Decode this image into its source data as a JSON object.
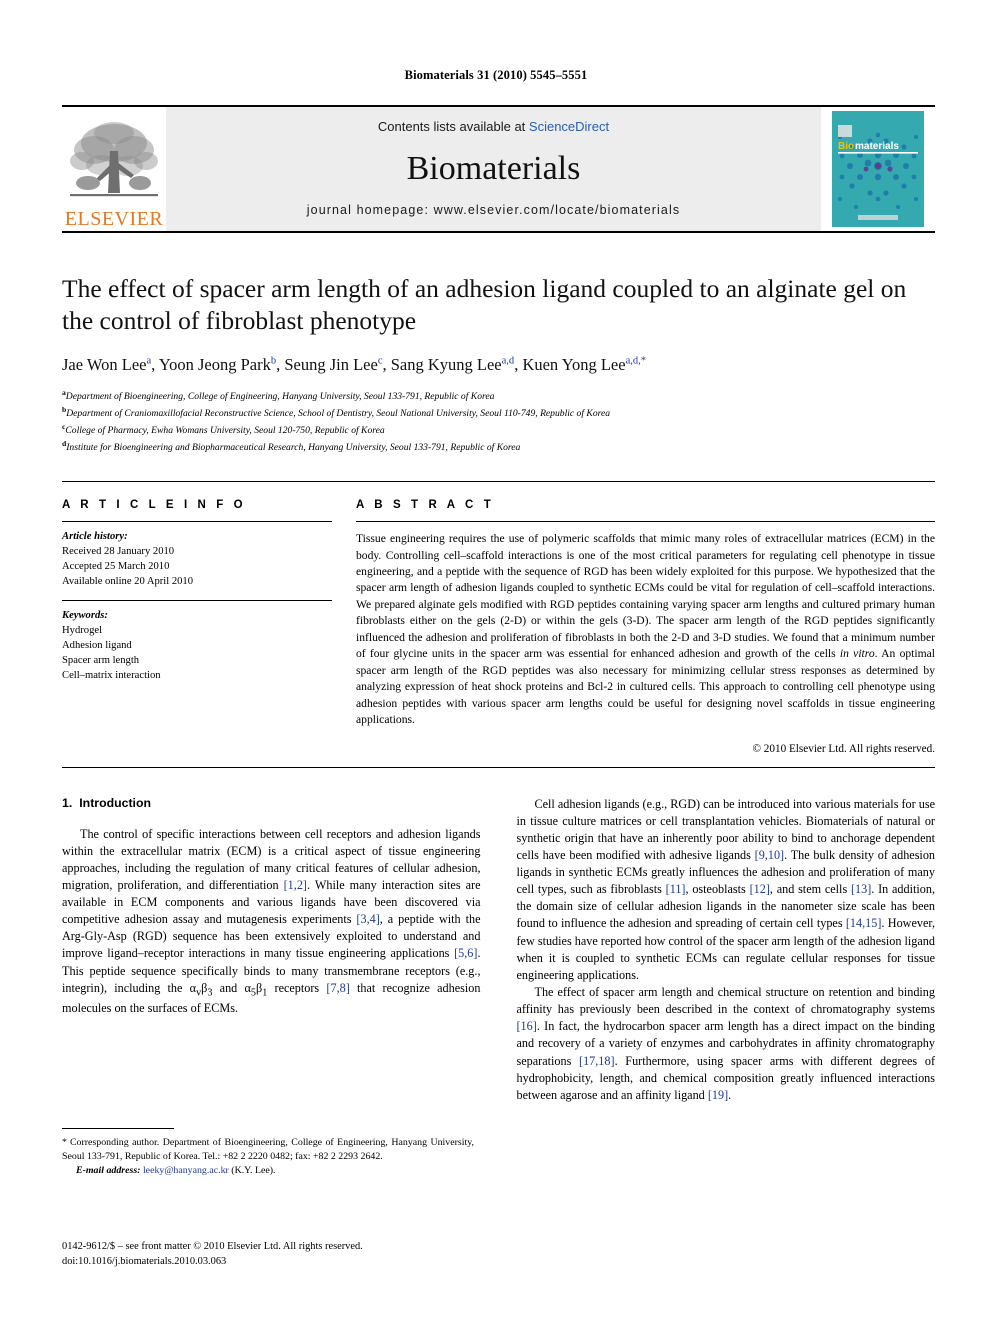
{
  "running_head": "Biomaterials 31 (2010) 5545–5551",
  "masthead": {
    "publisher_name": "ELSEVIER",
    "contents_prefix": "Contents lists available at ",
    "contents_link": "ScienceDirect",
    "journal_name": "Biomaterials",
    "homepage": "journal homepage: www.elsevier.com/locate/biomaterials",
    "cover_title": "Biomaterials",
    "cover_color": "#2fa7ad",
    "link_color": "#2a5db0",
    "elsevier_orange": "#E87722"
  },
  "title": "The effect of spacer arm length of an adhesion ligand coupled to an alginate gel on the control of fibroblast phenotype",
  "authors": [
    {
      "name": "Jae Won Lee",
      "marks": "a"
    },
    {
      "name": "Yoon Jeong Park",
      "marks": "b"
    },
    {
      "name": "Seung Jin Lee",
      "marks": "c"
    },
    {
      "name": "Sang Kyung Lee",
      "marks": "a,d"
    },
    {
      "name": "Kuen Yong Lee",
      "marks": "a,d,*"
    }
  ],
  "affiliations": [
    {
      "mark": "a",
      "text": "Department of Bioengineering, College of Engineering, Hanyang University, Seoul 133-791, Republic of Korea"
    },
    {
      "mark": "b",
      "text": "Department of Craniomaxillofacial Reconstructive Science, School of Dentistry, Seoul National University, Seoul 110-749, Republic of Korea"
    },
    {
      "mark": "c",
      "text": "College of Pharmacy, Ewha Womans University, Seoul 120-750, Republic of Korea"
    },
    {
      "mark": "d",
      "text": "Institute for Bioengineering and Biopharmaceutical Research, Hanyang University, Seoul 133-791, Republic of Korea"
    }
  ],
  "article_info": {
    "heading": "A R T I C L E   I N F O",
    "history_label": "Article history:",
    "history": [
      "Received 28 January 2010",
      "Accepted 25 March 2010",
      "Available online 20 April 2010"
    ],
    "keywords_label": "Keywords:",
    "keywords": [
      "Hydrogel",
      "Adhesion ligand",
      "Spacer arm length",
      "Cell–matrix interaction"
    ]
  },
  "abstract": {
    "heading": "A B S T R A C T",
    "part1": "Tissue engineering requires the use of polymeric scaffolds that mimic many roles of extracellular matrices (ECM) in the body. Controlling cell–scaffold interactions is one of the most critical parameters for regulating cell phenotype in tissue engineering, and a peptide with the sequence of RGD has been widely exploited for this purpose. We hypothesized that the spacer arm length of adhesion ligands coupled to synthetic ECMs could be vital for regulation of cell–scaffold interactions. We prepared alginate gels modified with RGD peptides containing varying spacer arm lengths and cultured primary human fibroblasts either on the gels (2-D) or within the gels (3-D). The spacer arm length of the RGD peptides significantly influenced the adhesion and proliferation of fibroblasts in both the 2-D and 3-D studies. We found that a minimum number of four glycine units in the spacer arm was essential for enhanced adhesion and growth of the cells ",
    "italic1": "in vitro",
    "part2": ". An optimal spacer arm length of the RGD peptides was also necessary for minimizing cellular stress responses as determined by analyzing expression of heat shock proteins and Bcl-2 in cultured cells. This approach to controlling cell phenotype using adhesion peptides with various spacer arm lengths could be useful for designing novel scaffolds in tissue engineering applications.",
    "copyright": "© 2010 Elsevier Ltd. All rights reserved."
  },
  "introduction": {
    "number": "1.",
    "title": "Introduction",
    "left_p1_a": "The control of specific interactions between cell receptors and adhesion ligands within the extracellular matrix (ECM) is a critical aspect of tissue engineering approaches, including the regulation of many critical features of cellular adhesion, migration, proliferation, and differentiation ",
    "left_ref1": "[1,2]",
    "left_p1_b": ". While many interaction sites are available in ECM components and various ligands have been discovered via competitive adhesion assay and mutagenesis experiments ",
    "left_ref2": "[3,4]",
    "left_p1_c": ", a peptide with the Arg-Gly-Asp (RGD) sequence has been extensively exploited to understand and improve ligand–receptor interactions in many tissue engineering applications ",
    "left_ref3": "[5,6]",
    "left_p1_d": ". This peptide sequence specifically binds to many transmembrane receptors (e.g., integrin), including the ",
    "integrin1_base": "α",
    "integrin1_sub1": "v",
    "integrin1_beta": "β",
    "integrin1_sub2": "3",
    "integrin_and": " and ",
    "integrin2_base": "α",
    "integrin2_sub1": "5",
    "integrin2_beta": "β",
    "integrin2_sub2": "1",
    "left_p1_e": " receptors ",
    "left_ref4": "[7,8]",
    "left_p1_f": " that recognize adhesion molecules on the surfaces of ECMs.",
    "right_p1_a": "Cell adhesion ligands (e.g., RGD) can be introduced into various materials for use in tissue culture matrices or cell transplantation vehicles. Biomaterials of natural or synthetic origin that have an inherently poor ability to bind to anchorage dependent cells have been modified with adhesive ligands ",
    "right_ref1": "[9,10]",
    "right_p1_b": ". The bulk density of adhesion ligands in synthetic ECMs greatly influences the adhesion and proliferation of many cell types, such as fibroblasts ",
    "right_ref2": "[11]",
    "right_p1_c": ", osteoblasts ",
    "right_ref3": "[12]",
    "right_p1_d": ", and stem cells ",
    "right_ref4": "[13]",
    "right_p1_e": ". In addition, the domain size of cellular adhesion ligands in the nanometer size scale has been found to influence the adhesion and spreading of certain cell types ",
    "right_ref5": "[14,15]",
    "right_p1_f": ". However, few studies have reported how control of the spacer arm length of the adhesion ligand when it is coupled to synthetic ECMs can regulate cellular responses for tissue engineering applications.",
    "right_p2_a": "The effect of spacer arm length and chemical structure on retention and binding affinity has previously been described in the context of chromatography systems ",
    "right_p2_ref1": "[16]",
    "right_p2_b": ". In fact, the hydrocarbon spacer arm length has a direct impact on the binding and recovery of a variety of enzymes and carbohydrates in affinity chromatography separations ",
    "right_p2_ref2": "[17,18]",
    "right_p2_c": ". Furthermore, using spacer arms with different degrees of hydrophobicity, length, and chemical composition greatly influenced interactions between agarose and an affinity ligand ",
    "right_p2_ref3": "[19]",
    "right_p2_d": "."
  },
  "footnote": {
    "star": "*",
    "corresponding": "Corresponding author. Department of Bioengineering, College of Engineering, Hanyang University, Seoul 133-791, Republic of Korea. Tel.: +82 2 2220 0482; fax: +82 2 2293 2642.",
    "email_label": "E-mail address:",
    "email": "leeky@hanyang.ac.kr",
    "email_suffix": " (K.Y. Lee)."
  },
  "imprint": {
    "line1": "0142-9612/$ – see front matter © 2010 Elsevier Ltd. All rights reserved.",
    "line2": "doi:10.1016/j.biomaterials.2010.03.063"
  }
}
